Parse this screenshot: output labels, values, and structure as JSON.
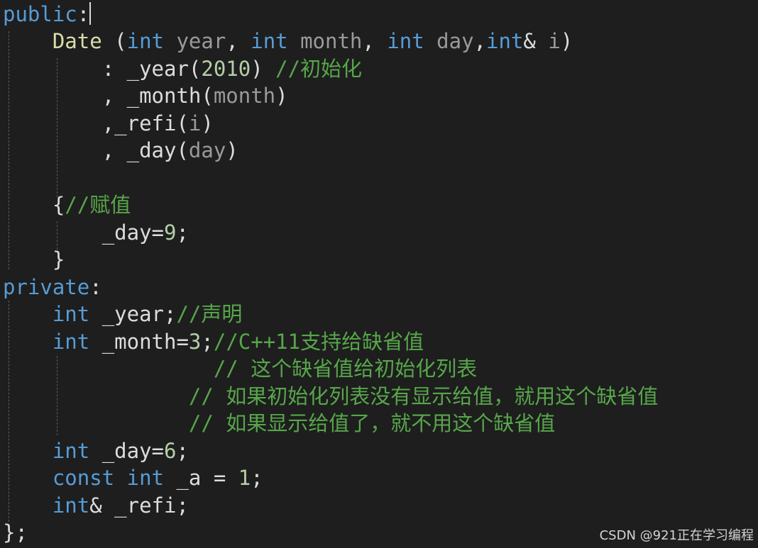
{
  "code": {
    "l01": {
      "kw": "public",
      "colon": ":"
    },
    "l02": {
      "fn": "Date",
      "open": " (",
      "kw1": "int",
      "p1": " year",
      "sep1": ", ",
      "kw2": "int",
      "p2": " month",
      "sep2": ", ",
      "kw3": "int",
      "p3": " day",
      "sep3": ",",
      "kw4": "int",
      "amp": "& ",
      "p4": "i",
      "close": ")"
    },
    "l03": {
      "prefix": ": _year(",
      "num": "2010",
      "close": ") ",
      "comment": "//初始化"
    },
    "l04": {
      "prefix": ", _month(",
      "arg": "month",
      "close": ")"
    },
    "l05": {
      "prefix": ",_refi(",
      "arg": "i",
      "close": ")"
    },
    "l06": {
      "prefix": ", _day(",
      "arg": "day",
      "close": ")"
    },
    "l07": {
      "brace": "{",
      "comment": "//赋值"
    },
    "l08": {
      "prefix": "_day=",
      "num": "9",
      "end": ";"
    },
    "l09": {
      "brace": "}"
    },
    "l10": {
      "kw": "private",
      "colon": ":"
    },
    "l11": {
      "kw": "int",
      "rest": " _year;",
      "comment": "//声明"
    },
    "l12": {
      "kw": "int",
      "prefix": " _month=",
      "num": "3",
      "end": ";",
      "comment": "//C++11支持给缺省值"
    },
    "l13": {
      "comment": "// 这个缺省值给初始化列表"
    },
    "l14": {
      "comment": "// 如果初始化列表没有显示给值，就用这个缺省值"
    },
    "l15": {
      "comment": "// 如果显示给值了，就不用这个缺省值"
    },
    "l16": {
      "kw": "int",
      "prefix": " _day=",
      "num": "6",
      "end": ";"
    },
    "l17": {
      "kw1": "const",
      "space": " ",
      "kw2": "int",
      "prefix": " _a = ",
      "num": "1",
      "end": ";"
    },
    "l18": {
      "kw": "int",
      "rest": "& _refi;"
    },
    "l19": {
      "text": "};"
    }
  },
  "watermark": "CSDN @921正在学习编程",
  "colors": {
    "background": "#1e1e1e",
    "keyword": "#569cd6",
    "function": "#dcdcaa",
    "comment": "#57a64a",
    "number": "#b5cea8",
    "parameter": "#9a9a9a",
    "default": "#dcdcdc"
  }
}
